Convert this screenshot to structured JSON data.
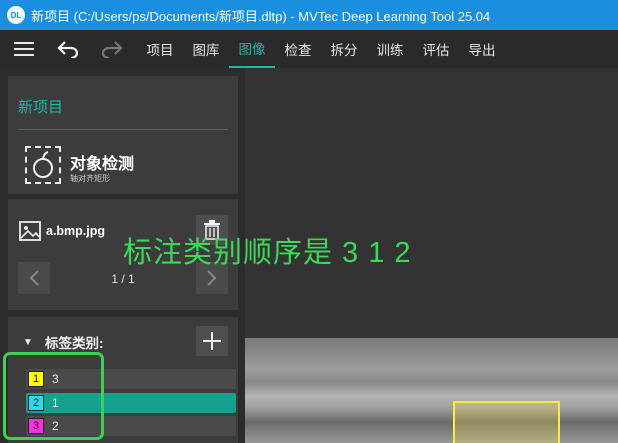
{
  "window": {
    "logo_text": "DL",
    "title": "新项目 (C:/Users/ps/Documents/新项目.dltp) - MVTec Deep Learning Tool 25.04"
  },
  "menu": {
    "items": [
      "项目",
      "图库",
      "图像",
      "检查",
      "拆分",
      "训练",
      "评估",
      "导出"
    ],
    "active": "图像"
  },
  "project": {
    "title": "新项目",
    "task": "对象检测",
    "task_sub": "轴对齐矩形"
  },
  "image": {
    "filename": "a.bmp.jpg",
    "page_indicator": "1 / 1"
  },
  "classes": {
    "header": "标签类别:",
    "items": [
      {
        "num": "1",
        "label": "3",
        "color": "#ffff00",
        "selected": false
      },
      {
        "num": "2",
        "label": "1",
        "color": "#2ed8f2",
        "selected": true
      },
      {
        "num": "3",
        "label": "2",
        "color": "#ff2fe6",
        "selected": false
      }
    ]
  },
  "annotation": {
    "text": "标注类别顺序是 3 1 2",
    "color": "#3bd957"
  },
  "colors": {
    "titlebar": "#1a8fe0",
    "accent": "#1fb8a4"
  }
}
